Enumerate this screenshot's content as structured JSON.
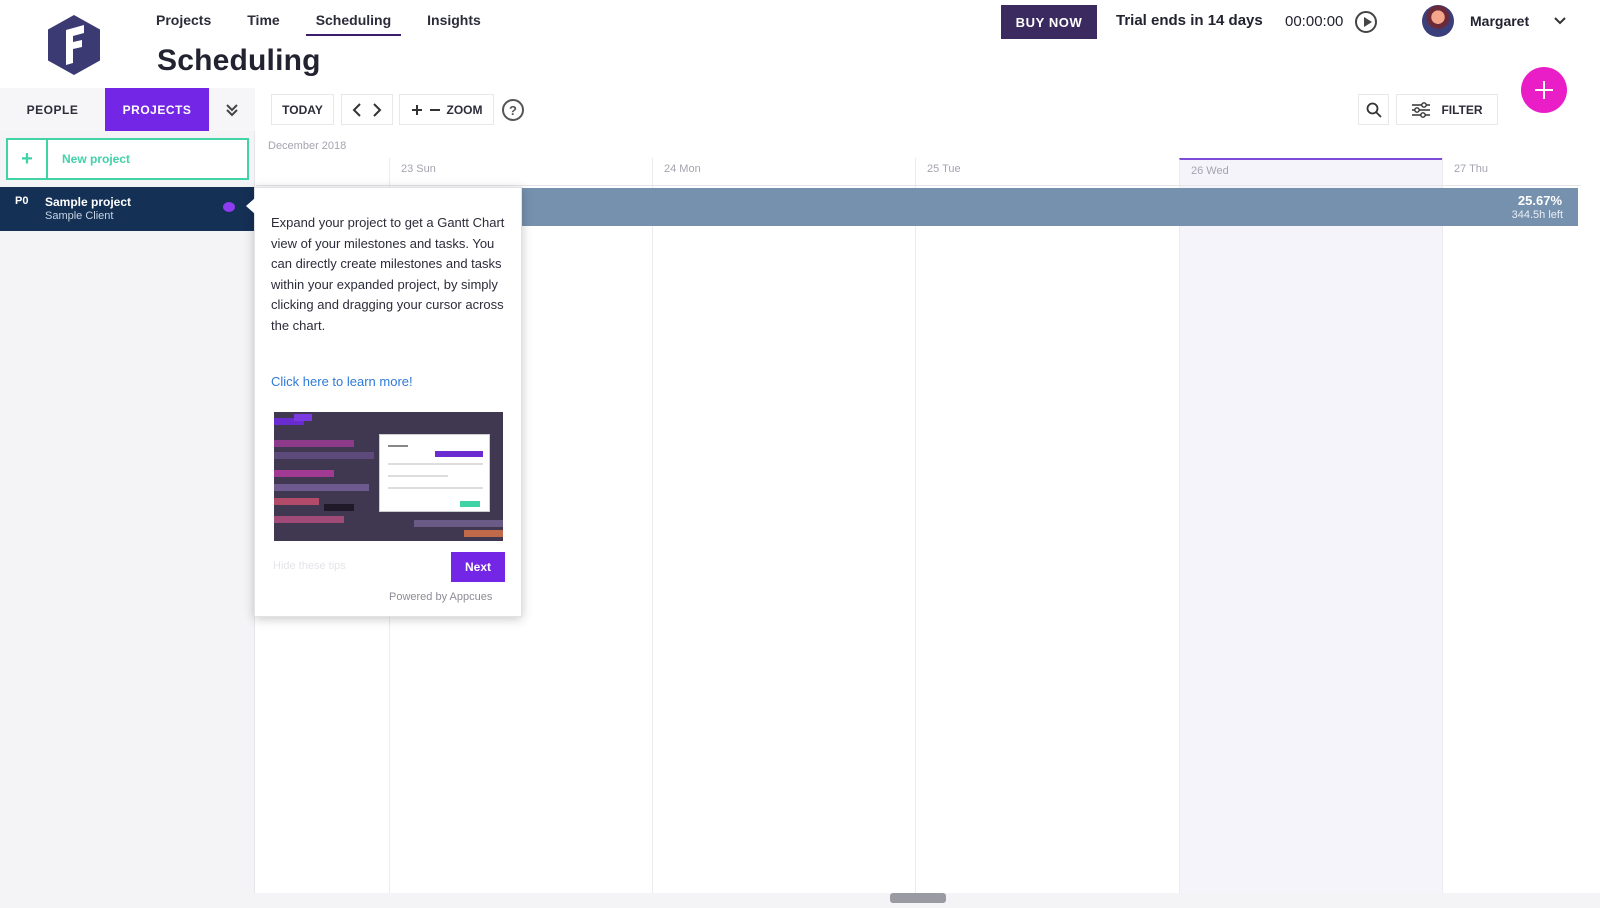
{
  "nav": {
    "items": [
      {
        "label": "Projects"
      },
      {
        "label": "Time"
      },
      {
        "label": "Scheduling",
        "active": true
      },
      {
        "label": "Insights"
      }
    ]
  },
  "page": {
    "title": "Scheduling"
  },
  "header": {
    "buy_label": "BUY NOW",
    "trial_text": "Trial ends in 14 days",
    "timer": "00:00:00",
    "user_name": "Margaret"
  },
  "left_tabs": {
    "people": "PEOPLE",
    "projects": "PROJECTS"
  },
  "toolbar": {
    "today": "TODAY",
    "zoom": "ZOOM",
    "help": "?",
    "filter": "FILTER"
  },
  "sidebar": {
    "new_project": "New project",
    "projects": [
      {
        "code": "P0",
        "name": "Sample project",
        "client": "Sample Client"
      }
    ]
  },
  "calendar": {
    "month": "December 2018",
    "days": [
      {
        "label": "23 Sun"
      },
      {
        "label": "24 Mon"
      },
      {
        "label": "25 Tue"
      },
      {
        "label": "26 Wed",
        "highlighted": true
      },
      {
        "label": "27 Thu"
      }
    ],
    "bar": {
      "percent": "25.67%",
      "left": "344.5h left"
    }
  },
  "tooltip": {
    "body": "Expand your project to get a Gantt Chart view of your milestones and tasks. You can directly create milestones and tasks within your expanded project, by simply clicking and dragging your cursor across the chart.",
    "link": "Click here to learn more!",
    "skip": "Hide these tips",
    "next": "Next",
    "powered": "Powered by Appcues"
  },
  "colors": {
    "brand_purple": "#7426e6",
    "fab_pink": "#e91ec6",
    "buy_button": "#3b2a5f",
    "project_row": "#143055",
    "gantt_bar": "#7591ae",
    "new_project_green": "#3fd3a6"
  }
}
